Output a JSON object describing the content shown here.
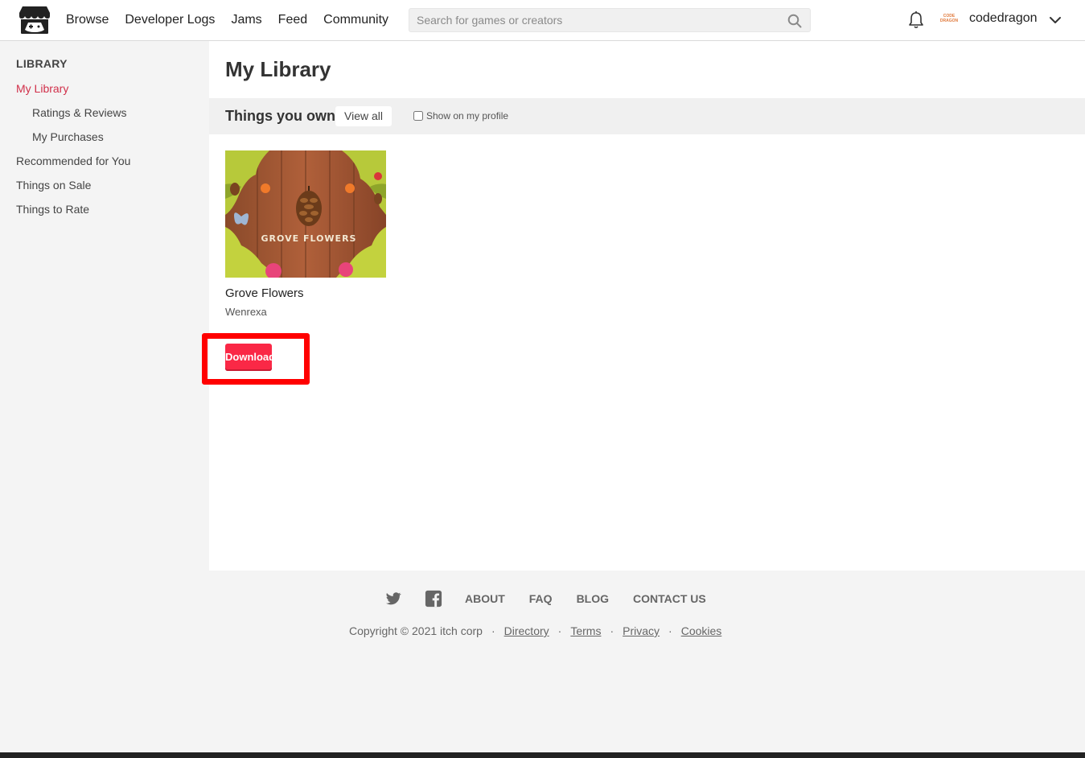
{
  "header": {
    "nav": [
      "Browse",
      "Developer Logs",
      "Jams",
      "Feed",
      "Community"
    ],
    "search_placeholder": "Search for games or creators",
    "username": "codedragon",
    "avatar_text": "CODE DRAGON"
  },
  "sidebar": {
    "heading": "LIBRARY",
    "items": [
      "My Library",
      "Ratings & Reviews",
      "My Purchases",
      "Recommended for You",
      "Things on Sale",
      "Things to Rate"
    ],
    "active_item": "My Library"
  },
  "main": {
    "title": "My Library",
    "section_title": "Things you own",
    "view_all_label": "View all",
    "show_on_profile_label": "Show on my profile",
    "show_on_profile_checked": false,
    "game": {
      "title": "Grove Flowers",
      "author": "Wenrexa",
      "thumbnail_text": "GROVE FLOWERS",
      "download_label": "Download"
    }
  },
  "footer": {
    "links": [
      "ABOUT",
      "FAQ",
      "BLOG",
      "CONTACT US"
    ],
    "social_icons": [
      "twitter-icon",
      "facebook-icon"
    ],
    "copyright": "Copyright © 2021 itch corp",
    "legal_links": [
      "Directory",
      "Terms",
      "Privacy",
      "Cookies"
    ]
  },
  "colors": {
    "accent": "#fa2846",
    "active_sidebar": "#d1304a",
    "highlight_box": "#ff0000"
  }
}
